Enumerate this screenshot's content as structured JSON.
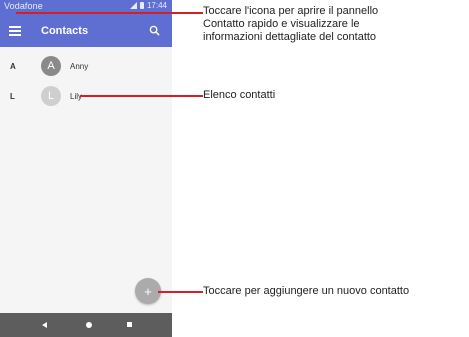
{
  "status_bar": {
    "carrier": "Vodafone",
    "time": "17:44",
    "signal_icon": "signal-icon",
    "battery_icon": "battery-icon"
  },
  "toolbar": {
    "title": "Contacts",
    "menu_icon": "menu-icon",
    "search_icon": "search-icon"
  },
  "contacts": [
    {
      "section": "A",
      "initial": "A",
      "name": "Anny",
      "avatar_color": "#8a8a8a"
    },
    {
      "section": "L",
      "initial": "L",
      "name": "Lily",
      "avatar_color": "#cfcfcf"
    }
  ],
  "fab": {
    "label": "+"
  },
  "nav_bar": {
    "back_icon": "back-icon",
    "home_icon": "home-icon",
    "recents_icon": "recents-icon"
  },
  "callouts": {
    "menu": [
      "Toccare l'icona per aprire il pannello",
      "Contatto rapido e visualizzare le",
      "informazioni dettagliate del contatto"
    ],
    "list": "Elenco contatti",
    "add": "Toccare per aggiungere un nuovo contatto"
  },
  "colors": {
    "accent": "#5f6ed1",
    "callout_line": "#d51f27",
    "nav_bar": "#5d5d5d",
    "fab": "#ababab"
  }
}
